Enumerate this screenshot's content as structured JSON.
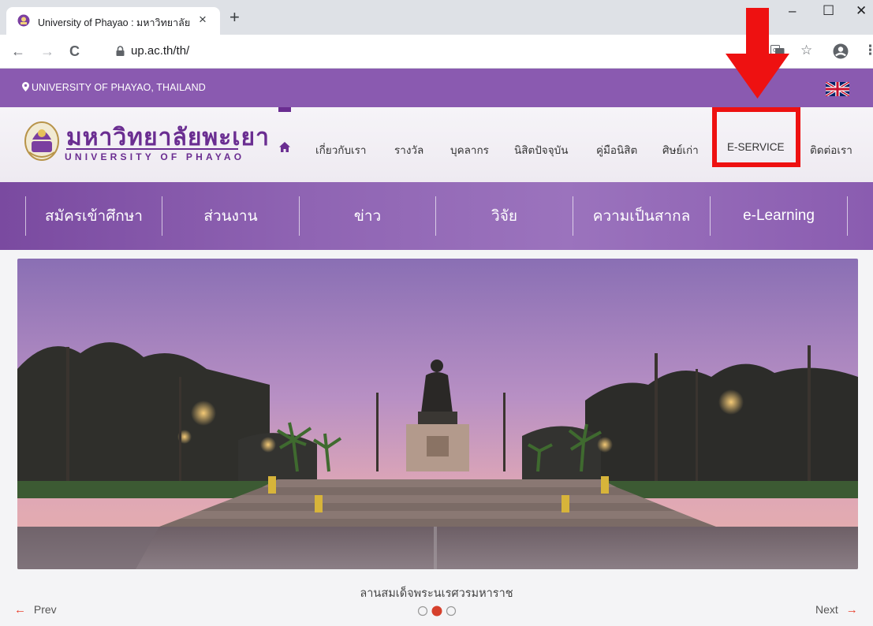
{
  "browser": {
    "tab_title": "University of Phayao : มหาวิทยาลัย",
    "tab_close": "×",
    "new_tab": "+",
    "window_minimize": "–",
    "window_maximize": "☐",
    "window_close": "✕",
    "back": "←",
    "forward": "→",
    "reload": "C",
    "url": "up.ac.th/th/",
    "star": "☆",
    "menu": "⋮"
  },
  "site": {
    "location_text": "UNIVERSITY OF PHAYAO, THAILAND",
    "logo_thai": "มหาวิทยาลัยพะเยา",
    "logo_english": "UNIVERSITY OF PHAYAO",
    "main_nav": [
      {
        "label": "เกี่ยวกับเรา"
      },
      {
        "label": "รางวัล"
      },
      {
        "label": "บุคลากร"
      },
      {
        "label": "นิสิตปัจจุบัน"
      },
      {
        "label": "คู่มือนิสิต"
      },
      {
        "label": "ศิษย์เก่า"
      },
      {
        "label": "E-SERVICE"
      },
      {
        "label": "ติดต่อเรา"
      }
    ],
    "category_nav": [
      {
        "label": "สมัครเข้าศึกษา"
      },
      {
        "label": "ส่วนงาน"
      },
      {
        "label": "ข่าว"
      },
      {
        "label": "วิจัย"
      },
      {
        "label": "ความเป็นสากล"
      },
      {
        "label": "e-Learning"
      }
    ],
    "slider_caption": "ลานสมเด็จพระนเรศวรมหาราช",
    "prev_label": "Prev",
    "next_label": "Next",
    "prev_arrow": "←",
    "next_arrow": "→",
    "slide_active_index": 2,
    "slide_count": 3
  },
  "colors": {
    "brand_purple": "#6a2d91",
    "strip_purple": "#8a5ab0",
    "highlight_red": "#ee1111",
    "link_red": "#e8412e"
  }
}
